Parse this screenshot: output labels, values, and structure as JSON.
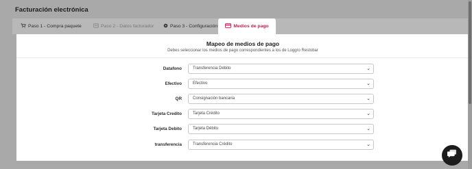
{
  "page": {
    "title": "Facturación electrónica"
  },
  "tabs": [
    {
      "label": "Paso 1 - Compra paquete",
      "icon": "cart-icon",
      "state": "normal"
    },
    {
      "label": "Paso 2 - Datos facturador",
      "icon": "user-card-icon",
      "state": "disabled"
    },
    {
      "label": "Paso 3 - Configuración",
      "icon": "gear-icon",
      "state": "normal"
    },
    {
      "label": "Medios de pago",
      "icon": "credit-card-icon",
      "state": "active"
    }
  ],
  "panel": {
    "title": "Mapeo de medios de pago",
    "subtitle": "Debes seleccionar los medios de pago correspondientes a los de Loggro Restobar"
  },
  "mappings": [
    {
      "label": "Datafono",
      "value": "Transferencia Débito"
    },
    {
      "label": "Efectivo",
      "value": "Efectivo"
    },
    {
      "label": "QR",
      "value": "Consignación bancaria"
    },
    {
      "label": "Tarjeta Credito",
      "value": "Tarjeta Crédito"
    },
    {
      "label": "Tarjeta Debito",
      "value": "Tarjeta Débito"
    },
    {
      "label": "transferencia",
      "value": "Transferencia Crédito"
    }
  ],
  "colors": {
    "accent": "#c21f4b",
    "overlay": "#a9a9a9",
    "chat_button": "#1c1c1c"
  },
  "chat": {
    "icon": "chat-bubble-icon"
  }
}
